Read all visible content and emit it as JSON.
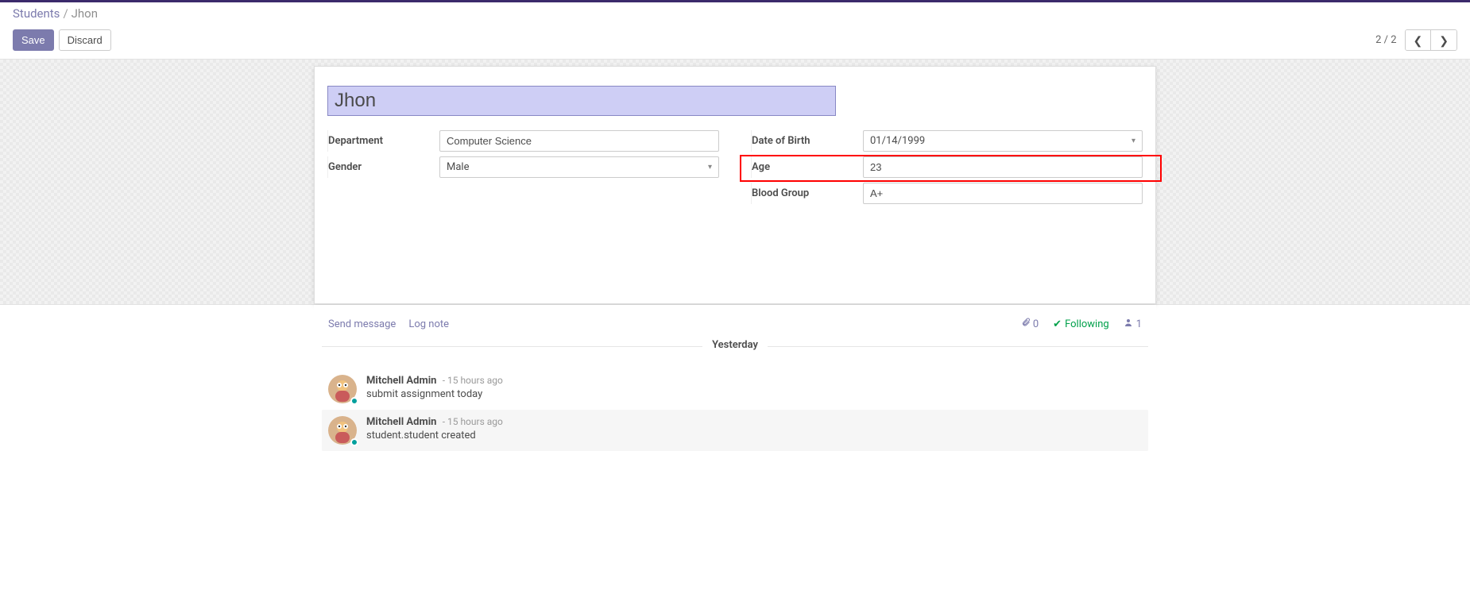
{
  "breadcrumb": {
    "root": "Students",
    "current": "Jhon"
  },
  "buttons": {
    "save": "Save",
    "discard": "Discard"
  },
  "pager": {
    "current": "2",
    "total": "2"
  },
  "record": {
    "name": "Jhon",
    "department_label": "Department",
    "department": "Computer Science",
    "gender_label": "Gender",
    "gender": "Male",
    "dob_label": "Date of Birth",
    "dob": "01/14/1999",
    "age_label": "Age",
    "age": "23",
    "bloodgroup_label": "Blood Group",
    "bloodgroup": "A+"
  },
  "chatter": {
    "send_message": "Send message",
    "log_note": "Log note",
    "attachment_count": "0",
    "following_label": "Following",
    "follower_count": "1",
    "divider": "Yesterday",
    "messages": [
      {
        "author": "Mitchell Admin",
        "meta": "- 15 hours ago",
        "text": "submit assignment today"
      },
      {
        "author": "Mitchell Admin",
        "meta": "- 15 hours ago",
        "text": "student.student created"
      }
    ]
  }
}
